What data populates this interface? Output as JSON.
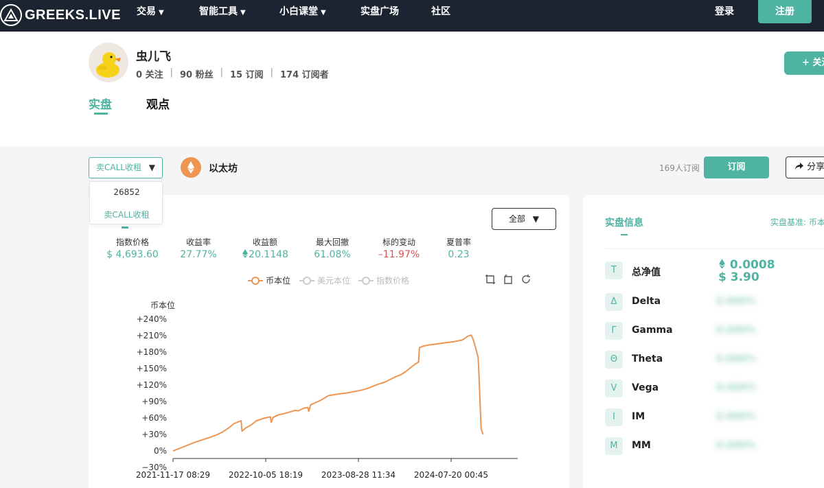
{
  "nav": {
    "brand": "GREEKS.LIVE",
    "items": [
      {
        "label": "交易",
        "has_arrow": true
      },
      {
        "label": "智能工具",
        "has_arrow": true
      },
      {
        "label": "小白课堂",
        "has_arrow": true
      },
      {
        "label": "实盘广场",
        "has_arrow": false
      },
      {
        "label": "社区",
        "has_arrow": false
      }
    ],
    "arrow": "▼",
    "login": "登录",
    "register": "注册"
  },
  "profile": {
    "username": "虫儿飞",
    "following": "0 关注",
    "fans": "90 粉丝",
    "subscriptions": "15 订阅",
    "subscribers": "174 订阅者",
    "separator": "|",
    "follow_button": "+ 关注",
    "tabs": [
      "实盘",
      "观点"
    ]
  },
  "strategy": {
    "selected": "卖CALL收租",
    "select_arrow": "▼",
    "dropdown_items": [
      "26852",
      "卖CALL收租"
    ],
    "asset": "以太坊",
    "subscriber_count": "169人订阅",
    "subscribe_button": "订阅",
    "share_button": "分享"
  },
  "metrics": {
    "range": "全部",
    "items": [
      {
        "label": "指数价格",
        "value": "$ 4,693.60"
      },
      {
        "label": "收益率",
        "value": "27.77%"
      },
      {
        "label": "收益额",
        "value": "20.1148"
      },
      {
        "label": "最大回撤",
        "value": "61.08%"
      },
      {
        "label": "标的变动",
        "value": "–11.97%"
      },
      {
        "label": "夏普率",
        "value": "0.23"
      }
    ]
  },
  "colors": {
    "accent": "#4fb3a2",
    "orange": "#ef9552",
    "negative": "#d9534f",
    "nav_bg": "#1b2430"
  },
  "chart_data": {
    "type": "line",
    "ylabel": "币本位",
    "legend": [
      "币本位",
      "美元本位",
      "指数价格"
    ],
    "legend_active": "币本位",
    "y_ticks": [
      "+240%",
      "+210%",
      "+180%",
      "+150%",
      "+120%",
      "+90%",
      "+60%",
      "+30%",
      "0%",
      "−30%"
    ],
    "x_ticks": [
      "2021-11-17 08:29",
      "2022-10-05 18:19",
      "2023-08-28 11:34",
      "2024-07-20 00:45"
    ],
    "ylim": [
      -30,
      240
    ],
    "series": [
      {
        "name": "币本位",
        "color": "#ef9552",
        "points": [
          [
            0.0,
            0
          ],
          [
            0.02,
            4
          ],
          [
            0.05,
            10
          ],
          [
            0.08,
            16
          ],
          [
            0.11,
            21
          ],
          [
            0.14,
            26
          ],
          [
            0.16,
            30
          ],
          [
            0.18,
            35
          ],
          [
            0.2,
            42
          ],
          [
            0.22,
            50
          ],
          [
            0.235,
            53
          ],
          [
            0.245,
            55
          ],
          [
            0.248,
            36
          ],
          [
            0.262,
            42
          ],
          [
            0.28,
            47
          ],
          [
            0.3,
            55
          ],
          [
            0.33,
            60
          ],
          [
            0.35,
            62
          ],
          [
            0.353,
            52
          ],
          [
            0.36,
            61
          ],
          [
            0.38,
            66
          ],
          [
            0.4,
            68
          ],
          [
            0.42,
            71
          ],
          [
            0.44,
            74
          ],
          [
            0.45,
            73
          ],
          [
            0.47,
            78
          ],
          [
            0.485,
            79
          ],
          [
            0.488,
            72
          ],
          [
            0.495,
            84
          ],
          [
            0.53,
            92
          ],
          [
            0.56,
            101
          ],
          [
            0.6,
            104
          ],
          [
            0.63,
            106
          ],
          [
            0.65,
            108
          ],
          [
            0.68,
            111
          ],
          [
            0.7,
            114
          ],
          [
            0.72,
            118
          ],
          [
            0.74,
            122
          ],
          [
            0.76,
            125
          ],
          [
            0.78,
            130
          ],
          [
            0.8,
            135
          ],
          [
            0.82,
            139
          ],
          [
            0.838,
            145
          ],
          [
            0.85,
            150
          ],
          [
            0.87,
            158
          ],
          [
            0.883,
            162
          ],
          [
            0.886,
            188
          ],
          [
            0.9,
            191
          ],
          [
            0.92,
            193
          ],
          [
            0.95,
            195
          ],
          [
            0.98,
            197
          ],
          [
            1.01,
            199
          ],
          [
            1.04,
            202
          ],
          [
            1.06,
            209
          ],
          [
            1.072,
            211
          ],
          [
            1.08,
            202
          ],
          [
            1.09,
            184
          ],
          [
            1.097,
            170
          ],
          [
            1.1,
            140
          ],
          [
            1.104,
            90
          ],
          [
            1.108,
            40
          ],
          [
            1.115,
            30
          ]
        ]
      }
    ]
  },
  "info": {
    "title": "实盘信息",
    "base": "实盘基准: 币本位",
    "net_value_coin": "0.0008",
    "net_value_usd": "$ 3.90",
    "rows": [
      {
        "badge": "T",
        "name": "总净值"
      },
      {
        "badge": "Δ",
        "name": "Delta",
        "value": "0.000%"
      },
      {
        "badge": "Γ",
        "name": "Gamma",
        "value": "0.000%"
      },
      {
        "badge": "Θ",
        "name": "Theta",
        "value": "0.000%"
      },
      {
        "badge": "V",
        "name": "Vega",
        "value": "0.000%"
      },
      {
        "badge": "I",
        "name": "IM",
        "value": "0.000%"
      },
      {
        "badge": "M",
        "name": "MM",
        "value": "0.000%"
      }
    ]
  }
}
